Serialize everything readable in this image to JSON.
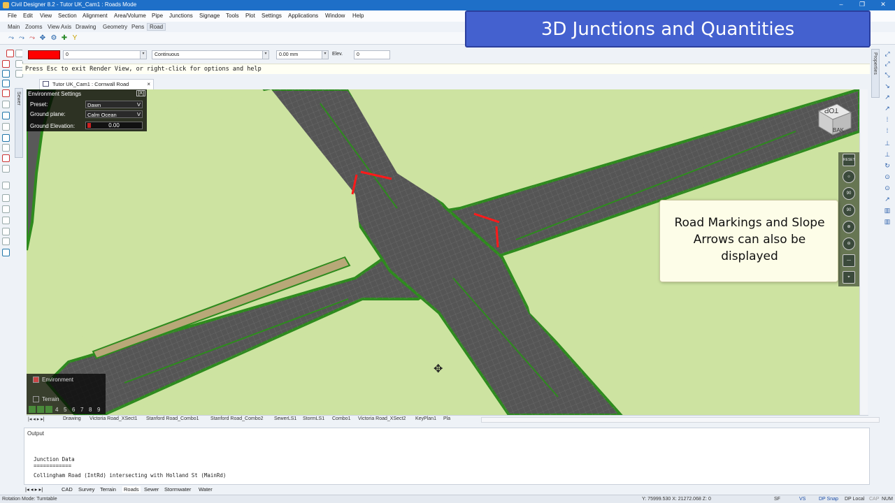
{
  "window": {
    "title": "Civil Designer 8.2 - Tutor UK_Cam1 : Roads Mode",
    "min": "–",
    "max": "❐",
    "close": "✕"
  },
  "menu": [
    "File",
    "Edit",
    "View",
    "Section",
    "Alignment",
    "Area/Volume",
    "Pipe",
    "Junctions",
    "Signage",
    "Tools",
    "Plot",
    "Settings",
    "Applications",
    "Window",
    "Help"
  ],
  "ribbon_tabs": [
    "Main",
    "Zooms",
    "View Axis",
    "Drawing",
    "Geometry",
    "Pens",
    "Road"
  ],
  "banner": "3D Junctions and Quantities",
  "props": {
    "layer_value": "0",
    "linetype": "Continuous",
    "width": "0.00 mm",
    "elev_label": "Elev.",
    "elev_value": "0",
    "drop": "▾"
  },
  "command": "Press Esc to exit Render View, or right-click for options and help",
  "left_vtab": "Sewer",
  "right_vtab": "Properties",
  "doc_tab": {
    "label": "Tutor UK_Cam1 : Cornwall Road",
    "close": "×"
  },
  "env": {
    "title": "Environment Settings",
    "close": "[X]",
    "preset_label": "Preset:",
    "preset": "Dawn",
    "ground_label": "Ground plane:",
    "ground": "Calm Ocean",
    "elev_label": "Ground Elevation:",
    "elev": "0.00",
    "v": "V"
  },
  "layers": {
    "environment": "Environment",
    "terrain": "Terrain",
    "tabs": [
      "4",
      "5",
      "6",
      "7",
      "8",
      "9"
    ]
  },
  "view_buttons": [
    "RESET",
    "☼",
    "90",
    "90",
    "⊕",
    "⊖",
    "—",
    "⌖"
  ],
  "cube": {
    "top": "TOP",
    "back": "BAK"
  },
  "callout": "Road Markings and Slope Arrows can also be displayed",
  "sheet_tabs": [
    "Drawing",
    "Victoria Road_XSect1",
    "Stanford Road_Combo1",
    "Stanford Road_Combo2",
    "SewerLS1",
    "StormLS1",
    "Combo1",
    "Victoria Road_XSect2",
    "KeyPlan1",
    "Pla"
  ],
  "output": {
    "title": "Output",
    "lines": [
      "Junction Data",
      "============",
      "Collingham Road (IntRd) intersecting with Holland St (MainRd)"
    ]
  },
  "output_tabs": [
    "CAD",
    "Survey",
    "Terrain",
    "Roads",
    "Sewer",
    "Stormwater",
    "Water"
  ],
  "status": {
    "mode": "Rotation Mode: Turntable",
    "coords": "Y: 75999.530 X: 21272.068 Z: 0",
    "sf": "SF",
    "vs": "VS",
    "dpsnap": "DP Snap",
    "dplocal": "DP Local",
    "cap": "CAP",
    "num": "NUM"
  },
  "colors": {
    "titlebar": "#1e6fc8",
    "banner": "#4461cf",
    "grass": "#cde3a1",
    "road": "#585858",
    "verge": "#2e8b1e",
    "marking": "#ff1a1a"
  }
}
